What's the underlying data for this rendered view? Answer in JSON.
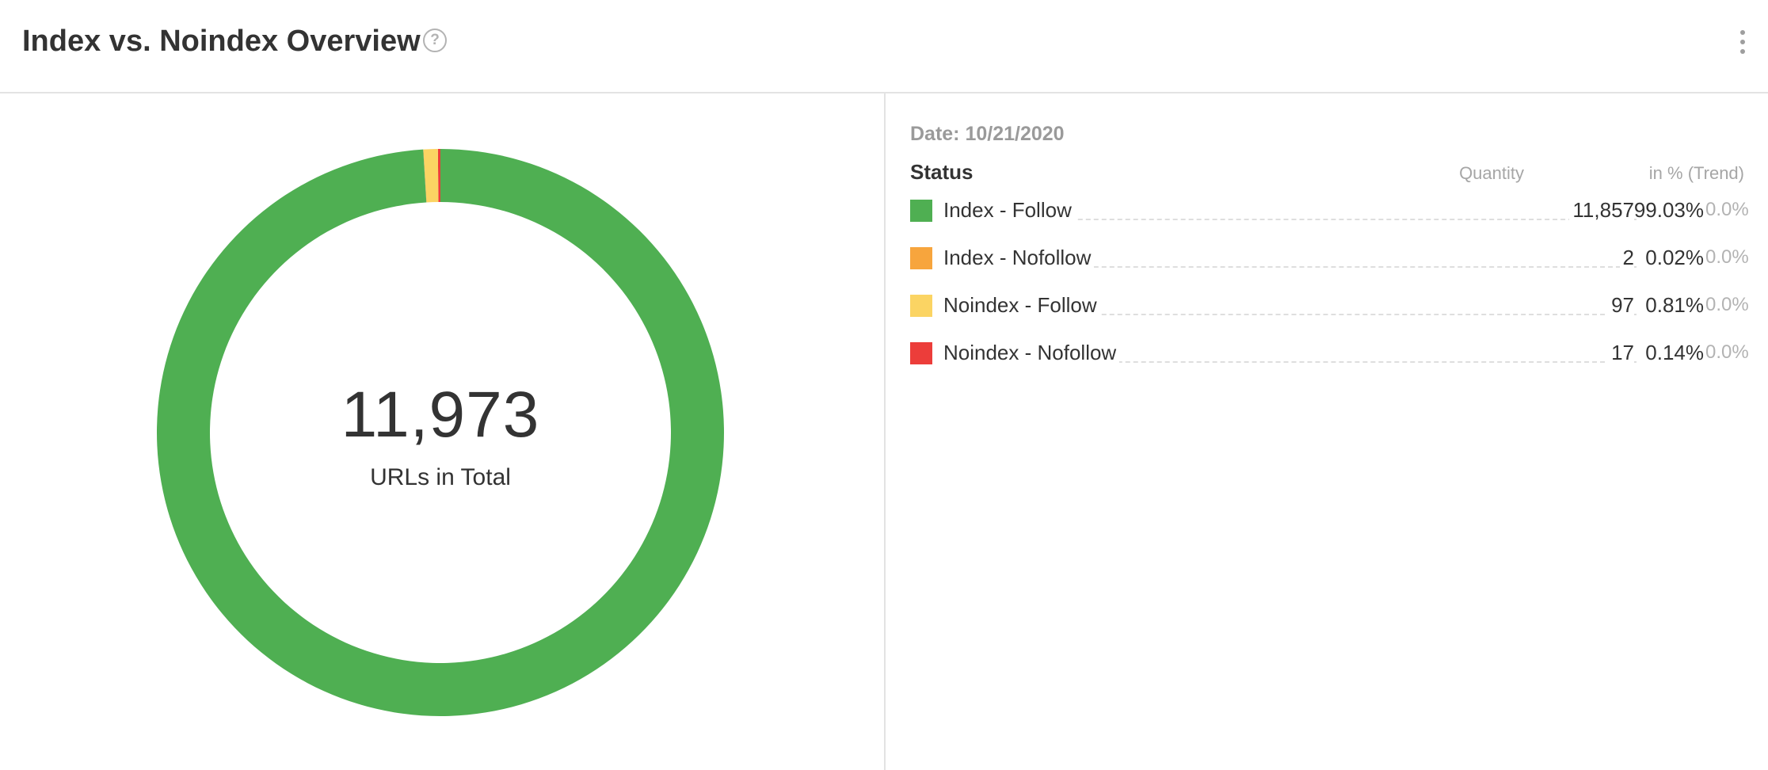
{
  "header": {
    "title": "Index vs. Noindex Overview",
    "help_icon": "question-circle-icon",
    "menu_icon": "more-vertical-icon"
  },
  "summary": {
    "total_value": "11,973",
    "total_label": "URLs in Total"
  },
  "legend": {
    "date": "Date: 10/21/2020",
    "col_status": "Status",
    "col_quantity": "Quantity",
    "col_percent": "in % (Trend)"
  },
  "chart_data": {
    "type": "pie",
    "variant": "donut",
    "title": "Index vs. Noindex Overview",
    "center_value": "11,973",
    "center_label": "URLs in Total",
    "categories": [
      "Index - Follow",
      "Index - Nofollow",
      "Noindex - Follow",
      "Noindex - Nofollow"
    ],
    "values": [
      11857,
      2,
      97,
      17
    ],
    "quantity_labels": [
      "11,857",
      "2",
      "97",
      "17"
    ],
    "percent_labels": [
      "99.03%",
      "0.02%",
      "0.81%",
      "0.14%"
    ],
    "trend_labels": [
      "0.0%",
      "0.0%",
      "0.0%",
      "0.0%"
    ],
    "colors": [
      "#4faf52",
      "#f7a53d",
      "#fbd463",
      "#ec3d3a"
    ],
    "legend_position": "right"
  }
}
